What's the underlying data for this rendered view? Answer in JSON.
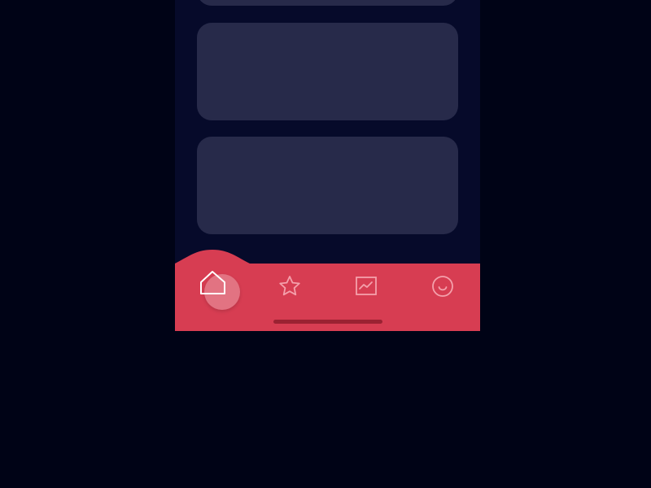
{
  "colors": {
    "page_background": "#000316",
    "app_background": "#060a2a",
    "card": "#272a4a",
    "tab_bar": "#d73d52",
    "home_indicator": "#9a2232",
    "active_icon": "#ffffff",
    "inactive_icon": "#f4a0ab"
  },
  "cards": [
    {
      "id": "card-top-partial"
    },
    {
      "id": "card-1"
    },
    {
      "id": "card-2"
    }
  ],
  "tab_bar": {
    "active_tab": "home",
    "tabs": [
      {
        "id": "home",
        "icon": "home-icon",
        "active": true
      },
      {
        "id": "favorites",
        "icon": "star-icon",
        "active": false
      },
      {
        "id": "stats",
        "icon": "chart-icon",
        "active": false
      },
      {
        "id": "profile",
        "icon": "smiley-icon",
        "active": false
      }
    ]
  }
}
